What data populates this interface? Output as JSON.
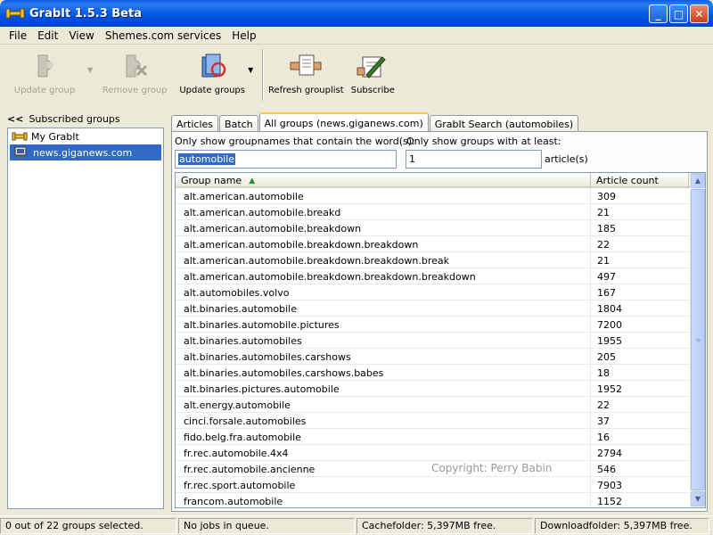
{
  "window": {
    "title": "GrabIt 1.5.3 Beta",
    "minimize": "_",
    "maximize": "□",
    "close": "✕"
  },
  "menu": [
    "File",
    "Edit",
    "View",
    "Shemes.com services",
    "Help"
  ],
  "toolbar": {
    "update_group": "Update group",
    "remove_group": "Remove group",
    "update_groups": "Update groups",
    "refresh_grouplist": "Refresh grouplist",
    "subscribe": "Subscribe",
    "dropdown_arrow": "▼"
  },
  "sidebar": {
    "collapse": "<<",
    "title": "Subscribed groups",
    "root": "My GrabIt",
    "server": "news.giganews.com"
  },
  "tabs": [
    "Articles",
    "Batch",
    "All groups (news.giganews.com)",
    "GrabIt Search (automobiles)"
  ],
  "filter": {
    "name_label": "Only show groupnames that contain the word(s):",
    "name_value": "automobile",
    "count_label": "Only show groups with at least:",
    "count_value": "1",
    "count_suffix": "article(s)"
  },
  "table": {
    "col_name": "Group name",
    "col_count": "Article count",
    "sort_indicator": "▲",
    "rows": [
      {
        "name": "alt.american.automobile",
        "count": "309"
      },
      {
        "name": "alt.american.automobile.breakd",
        "count": "21"
      },
      {
        "name": "alt.american.automobile.breakdown",
        "count": "185"
      },
      {
        "name": "alt.american.automobile.breakdown.breakdown",
        "count": "22"
      },
      {
        "name": "alt.american.automobile.breakdown.breakdown.break",
        "count": "21"
      },
      {
        "name": "alt.american.automobile.breakdown.breakdown.breakdown",
        "count": "497"
      },
      {
        "name": "alt.automobiles.volvo",
        "count": "167"
      },
      {
        "name": "alt.binaries.automobile",
        "count": "1804"
      },
      {
        "name": "alt.binaries.automobile.pictures",
        "count": "7200"
      },
      {
        "name": "alt.binaries.automobiles",
        "count": "1955"
      },
      {
        "name": "alt.binaries.automobiles.carshows",
        "count": "205"
      },
      {
        "name": "alt.binaries.automobiles.carshows.babes",
        "count": "18"
      },
      {
        "name": "alt.binaries.pictures.automobile",
        "count": "1952"
      },
      {
        "name": "alt.energy.automobile",
        "count": "22"
      },
      {
        "name": "cinci.forsale.automobiles",
        "count": "37"
      },
      {
        "name": "fido.belg.fra.automobile",
        "count": "16"
      },
      {
        "name": "fr.rec.automobile.4x4",
        "count": "2794"
      },
      {
        "name": "fr.rec.automobile.ancienne",
        "count": "546"
      },
      {
        "name": "fr.rec.sport.automobile",
        "count": "7903"
      },
      {
        "name": "francom.automobile",
        "count": "1152"
      }
    ]
  },
  "watermark": "Copyright: Perry Babin",
  "status": {
    "selection": "0 out of 22 groups selected.",
    "jobs": "No jobs in queue.",
    "cache": "Cachefolder: 5,397MB free.",
    "download": "Downloadfolder: 5,397MB free."
  }
}
